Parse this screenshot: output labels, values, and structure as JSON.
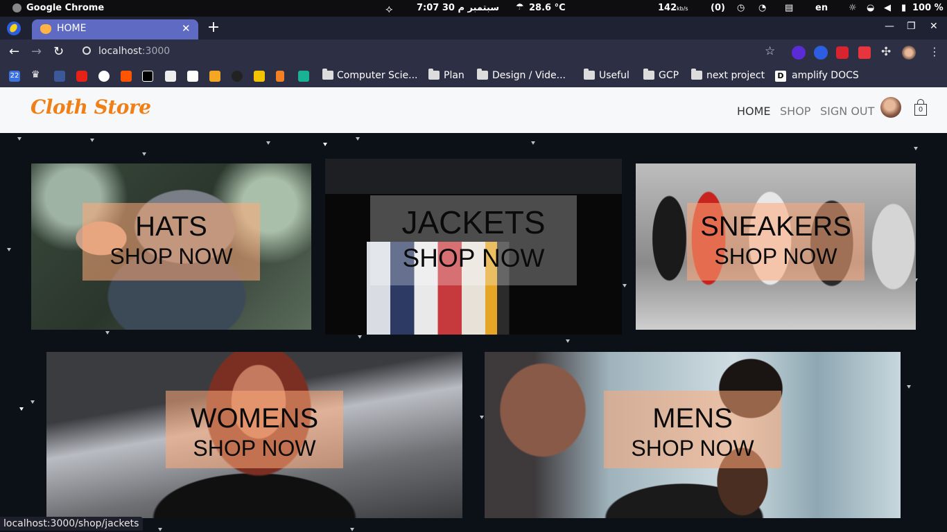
{
  "os_bar": {
    "app_name": "Google Chrome",
    "clock": "7:07  30 سبتمبر  م",
    "temperature": "28.6 °C",
    "net_speed": "142",
    "net_unit": "kb/s",
    "notifications": "(0)",
    "lang": "en",
    "battery": "100 %"
  },
  "tabs": {
    "active_title": "HOME"
  },
  "toolbar": {
    "url_host": "localhost",
    "url_port": ":3000"
  },
  "bookmarks": {
    "calendar_day": "22",
    "folders": [
      "Computer Scie...",
      "Plan",
      "Design / Vide...",
      "Useful",
      "GCP",
      "next project"
    ],
    "docs_label": "amplify DOCS",
    "docs_letter": "D"
  },
  "header": {
    "logo": "Cloth Store",
    "nav": [
      "HOME",
      "SHOP",
      "SIGN OUT"
    ],
    "cart_count": "0"
  },
  "categories": [
    {
      "title": "HATS",
      "cta": "SHOP NOW"
    },
    {
      "title": "JACKETS",
      "cta": "SHOP NOW"
    },
    {
      "title": "SNEAKERS",
      "cta": "SHOP NOW"
    },
    {
      "title": "WOMENS",
      "cta": "SHOP NOW"
    },
    {
      "title": "MENS",
      "cta": "SHOP NOW"
    }
  ],
  "status_bar": {
    "hover_url": "localhost:3000/shop/jackets"
  }
}
